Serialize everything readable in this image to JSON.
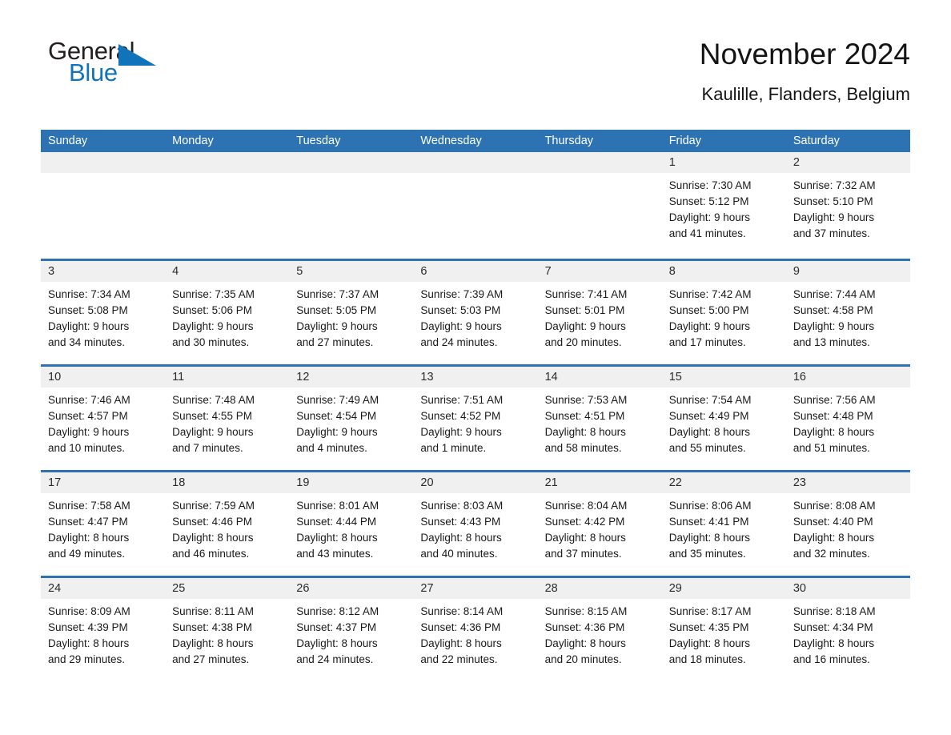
{
  "logo": {
    "word_one": "General",
    "word_two": "Blue",
    "triangle_color": "#1173ba"
  },
  "header": {
    "title": "November 2024",
    "subtitle": "Kaulille, Flanders, Belgium"
  },
  "theme": {
    "header_blue": "#2d73b3",
    "daynum_band": "#f0f0f0",
    "text": "#1a1a1a"
  },
  "calendar": {
    "weekday_headers": [
      "Sunday",
      "Monday",
      "Tuesday",
      "Wednesday",
      "Thursday",
      "Friday",
      "Saturday"
    ],
    "weeks": [
      [
        {
          "day": "",
          "sunrise": "",
          "sunset": "",
          "daylight_line1": "",
          "daylight_line2": ""
        },
        {
          "day": "",
          "sunrise": "",
          "sunset": "",
          "daylight_line1": "",
          "daylight_line2": ""
        },
        {
          "day": "",
          "sunrise": "",
          "sunset": "",
          "daylight_line1": "",
          "daylight_line2": ""
        },
        {
          "day": "",
          "sunrise": "",
          "sunset": "",
          "daylight_line1": "",
          "daylight_line2": ""
        },
        {
          "day": "",
          "sunrise": "",
          "sunset": "",
          "daylight_line1": "",
          "daylight_line2": ""
        },
        {
          "day": "1",
          "sunrise": "Sunrise: 7:30 AM",
          "sunset": "Sunset: 5:12 PM",
          "daylight_line1": "Daylight: 9 hours",
          "daylight_line2": "and 41 minutes."
        },
        {
          "day": "2",
          "sunrise": "Sunrise: 7:32 AM",
          "sunset": "Sunset: 5:10 PM",
          "daylight_line1": "Daylight: 9 hours",
          "daylight_line2": "and 37 minutes."
        }
      ],
      [
        {
          "day": "3",
          "sunrise": "Sunrise: 7:34 AM",
          "sunset": "Sunset: 5:08 PM",
          "daylight_line1": "Daylight: 9 hours",
          "daylight_line2": "and 34 minutes."
        },
        {
          "day": "4",
          "sunrise": "Sunrise: 7:35 AM",
          "sunset": "Sunset: 5:06 PM",
          "daylight_line1": "Daylight: 9 hours",
          "daylight_line2": "and 30 minutes."
        },
        {
          "day": "5",
          "sunrise": "Sunrise: 7:37 AM",
          "sunset": "Sunset: 5:05 PM",
          "daylight_line1": "Daylight: 9 hours",
          "daylight_line2": "and 27 minutes."
        },
        {
          "day": "6",
          "sunrise": "Sunrise: 7:39 AM",
          "sunset": "Sunset: 5:03 PM",
          "daylight_line1": "Daylight: 9 hours",
          "daylight_line2": "and 24 minutes."
        },
        {
          "day": "7",
          "sunrise": "Sunrise: 7:41 AM",
          "sunset": "Sunset: 5:01 PM",
          "daylight_line1": "Daylight: 9 hours",
          "daylight_line2": "and 20 minutes."
        },
        {
          "day": "8",
          "sunrise": "Sunrise: 7:42 AM",
          "sunset": "Sunset: 5:00 PM",
          "daylight_line1": "Daylight: 9 hours",
          "daylight_line2": "and 17 minutes."
        },
        {
          "day": "9",
          "sunrise": "Sunrise: 7:44 AM",
          "sunset": "Sunset: 4:58 PM",
          "daylight_line1": "Daylight: 9 hours",
          "daylight_line2": "and 13 minutes."
        }
      ],
      [
        {
          "day": "10",
          "sunrise": "Sunrise: 7:46 AM",
          "sunset": "Sunset: 4:57 PM",
          "daylight_line1": "Daylight: 9 hours",
          "daylight_line2": "and 10 minutes."
        },
        {
          "day": "11",
          "sunrise": "Sunrise: 7:48 AM",
          "sunset": "Sunset: 4:55 PM",
          "daylight_line1": "Daylight: 9 hours",
          "daylight_line2": "and 7 minutes."
        },
        {
          "day": "12",
          "sunrise": "Sunrise: 7:49 AM",
          "sunset": "Sunset: 4:54 PM",
          "daylight_line1": "Daylight: 9 hours",
          "daylight_line2": "and 4 minutes."
        },
        {
          "day": "13",
          "sunrise": "Sunrise: 7:51 AM",
          "sunset": "Sunset: 4:52 PM",
          "daylight_line1": "Daylight: 9 hours",
          "daylight_line2": "and 1 minute."
        },
        {
          "day": "14",
          "sunrise": "Sunrise: 7:53 AM",
          "sunset": "Sunset: 4:51 PM",
          "daylight_line1": "Daylight: 8 hours",
          "daylight_line2": "and 58 minutes."
        },
        {
          "day": "15",
          "sunrise": "Sunrise: 7:54 AM",
          "sunset": "Sunset: 4:49 PM",
          "daylight_line1": "Daylight: 8 hours",
          "daylight_line2": "and 55 minutes."
        },
        {
          "day": "16",
          "sunrise": "Sunrise: 7:56 AM",
          "sunset": "Sunset: 4:48 PM",
          "daylight_line1": "Daylight: 8 hours",
          "daylight_line2": "and 51 minutes."
        }
      ],
      [
        {
          "day": "17",
          "sunrise": "Sunrise: 7:58 AM",
          "sunset": "Sunset: 4:47 PM",
          "daylight_line1": "Daylight: 8 hours",
          "daylight_line2": "and 49 minutes."
        },
        {
          "day": "18",
          "sunrise": "Sunrise: 7:59 AM",
          "sunset": "Sunset: 4:46 PM",
          "daylight_line1": "Daylight: 8 hours",
          "daylight_line2": "and 46 minutes."
        },
        {
          "day": "19",
          "sunrise": "Sunrise: 8:01 AM",
          "sunset": "Sunset: 4:44 PM",
          "daylight_line1": "Daylight: 8 hours",
          "daylight_line2": "and 43 minutes."
        },
        {
          "day": "20",
          "sunrise": "Sunrise: 8:03 AM",
          "sunset": "Sunset: 4:43 PM",
          "daylight_line1": "Daylight: 8 hours",
          "daylight_line2": "and 40 minutes."
        },
        {
          "day": "21",
          "sunrise": "Sunrise: 8:04 AM",
          "sunset": "Sunset: 4:42 PM",
          "daylight_line1": "Daylight: 8 hours",
          "daylight_line2": "and 37 minutes."
        },
        {
          "day": "22",
          "sunrise": "Sunrise: 8:06 AM",
          "sunset": "Sunset: 4:41 PM",
          "daylight_line1": "Daylight: 8 hours",
          "daylight_line2": "and 35 minutes."
        },
        {
          "day": "23",
          "sunrise": "Sunrise: 8:08 AM",
          "sunset": "Sunset: 4:40 PM",
          "daylight_line1": "Daylight: 8 hours",
          "daylight_line2": "and 32 minutes."
        }
      ],
      [
        {
          "day": "24",
          "sunrise": "Sunrise: 8:09 AM",
          "sunset": "Sunset: 4:39 PM",
          "daylight_line1": "Daylight: 8 hours",
          "daylight_line2": "and 29 minutes."
        },
        {
          "day": "25",
          "sunrise": "Sunrise: 8:11 AM",
          "sunset": "Sunset: 4:38 PM",
          "daylight_line1": "Daylight: 8 hours",
          "daylight_line2": "and 27 minutes."
        },
        {
          "day": "26",
          "sunrise": "Sunrise: 8:12 AM",
          "sunset": "Sunset: 4:37 PM",
          "daylight_line1": "Daylight: 8 hours",
          "daylight_line2": "and 24 minutes."
        },
        {
          "day": "27",
          "sunrise": "Sunrise: 8:14 AM",
          "sunset": "Sunset: 4:36 PM",
          "daylight_line1": "Daylight: 8 hours",
          "daylight_line2": "and 22 minutes."
        },
        {
          "day": "28",
          "sunrise": "Sunrise: 8:15 AM",
          "sunset": "Sunset: 4:36 PM",
          "daylight_line1": "Daylight: 8 hours",
          "daylight_line2": "and 20 minutes."
        },
        {
          "day": "29",
          "sunrise": "Sunrise: 8:17 AM",
          "sunset": "Sunset: 4:35 PM",
          "daylight_line1": "Daylight: 8 hours",
          "daylight_line2": "and 18 minutes."
        },
        {
          "day": "30",
          "sunrise": "Sunrise: 8:18 AM",
          "sunset": "Sunset: 4:34 PM",
          "daylight_line1": "Daylight: 8 hours",
          "daylight_line2": "and 16 minutes."
        }
      ]
    ]
  }
}
